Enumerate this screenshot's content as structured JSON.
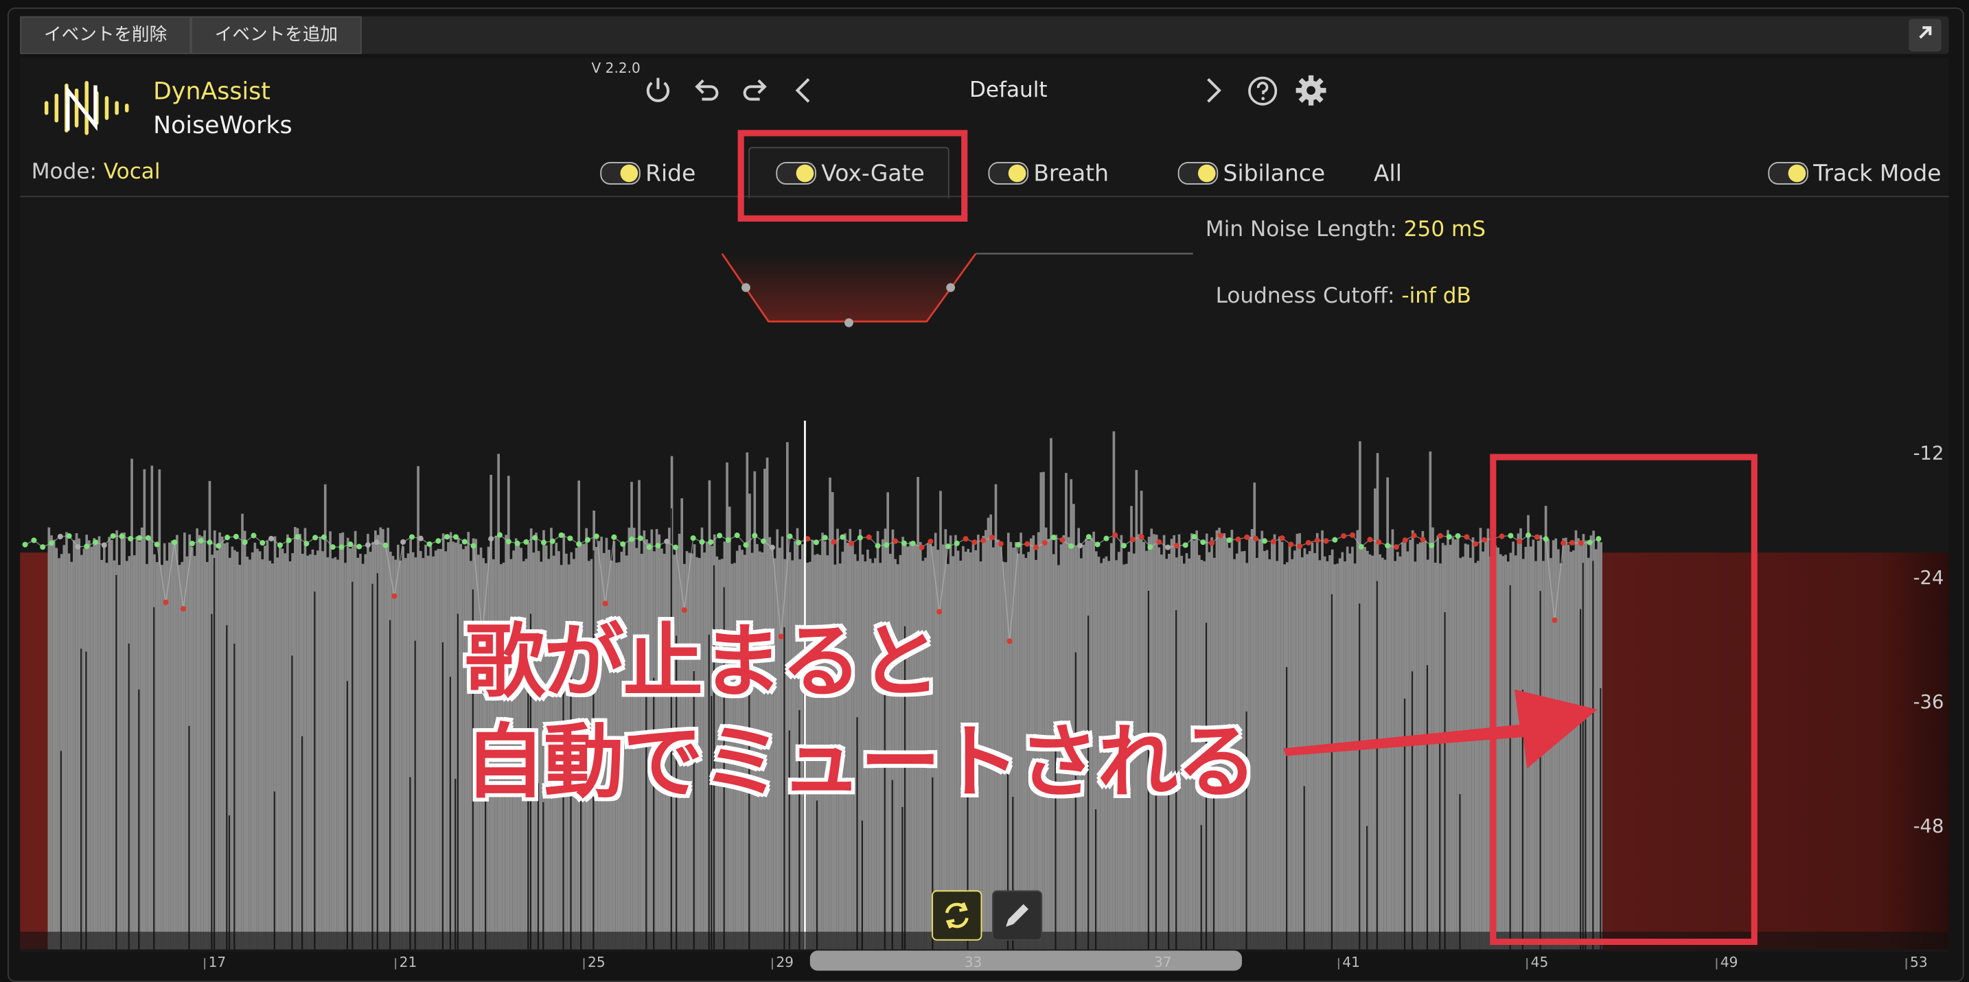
{
  "toolbar": {
    "delete_event": "イベントを削除",
    "add_event": "イベントを追加"
  },
  "header": {
    "brand_top": "DynAssist",
    "brand_bottom": "NoiseWorks",
    "version": "V 2.2.0",
    "preset": "Default"
  },
  "mode": {
    "label": "Mode:",
    "value": "Vocal"
  },
  "tabs": [
    {
      "label": "Ride"
    },
    {
      "label": "Vox-Gate"
    },
    {
      "label": "Breath"
    },
    {
      "label": "Sibilance"
    },
    {
      "label": "All"
    }
  ],
  "track_mode": "Track Mode",
  "params": {
    "min_noise_label": "Min Noise Length:",
    "min_noise_value": "250 mS",
    "loudness_label": "Loudness Cutoff:",
    "loudness_value": "-inf dB"
  },
  "db_scale": [
    "-12",
    "-24",
    "-36",
    "-48"
  ],
  "timeline": [
    "17",
    "21",
    "25",
    "29",
    "33",
    "37",
    "41",
    "45",
    "49",
    "53"
  ],
  "annotation": {
    "line1": "歌が止まると",
    "line2": "自動でミュートされる"
  },
  "colors": {
    "accent_yellow": "#f4e46a",
    "annotation_red": "#e03542",
    "gate_red": "#d83a2e",
    "waveform_gray": "#8a8a8a",
    "point_green": "#7ee07a"
  },
  "icons": [
    "logo-icon",
    "power-icon",
    "undo-icon",
    "redo-icon",
    "chevron-left-icon",
    "chevron-right-icon",
    "help-icon",
    "gear-icon",
    "expand-icon",
    "loop-icon",
    "pencil-icon"
  ]
}
